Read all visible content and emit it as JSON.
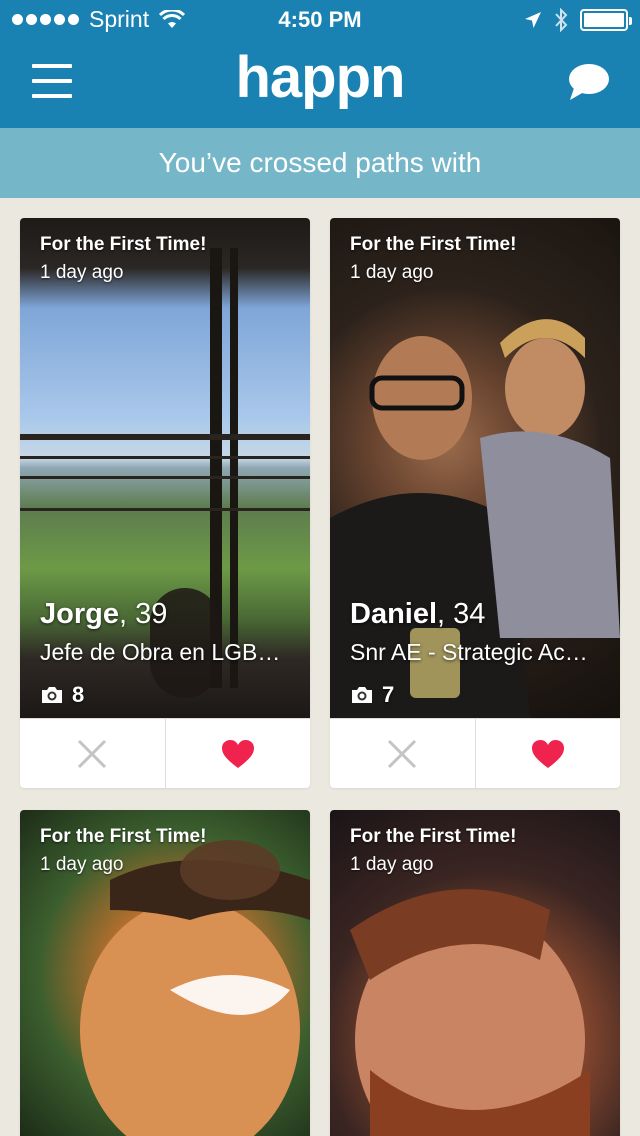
{
  "status_bar": {
    "carrier": "Sprint",
    "time": "4:50 PM"
  },
  "header": {
    "logo": "happn",
    "menu_icon": "hamburger-menu-icon",
    "chat_icon": "chat-bubble-icon",
    "color": "#1a82b2"
  },
  "subheader": {
    "text": "You’ve crossed paths with",
    "color": "#75b6c8"
  },
  "cards": [
    {
      "first_label": "For the First Time!",
      "ago": "1 day ago",
      "name": "Jorge",
      "age": ", 39",
      "job": "Jefe de Obra en LGB…",
      "photo_count": "8"
    },
    {
      "first_label": "For the First Time!",
      "ago": "1 day ago",
      "name": "Daniel",
      "age": ", 34",
      "job": "Snr AE - Strategic Ac…",
      "photo_count": "7"
    },
    {
      "first_label": "For the First Time!",
      "ago": "1 day ago"
    },
    {
      "first_label": "For the First Time!",
      "ago": "1 day ago"
    }
  ],
  "colors": {
    "heart": "#f0224e",
    "dismiss": "#c4c4c4"
  }
}
